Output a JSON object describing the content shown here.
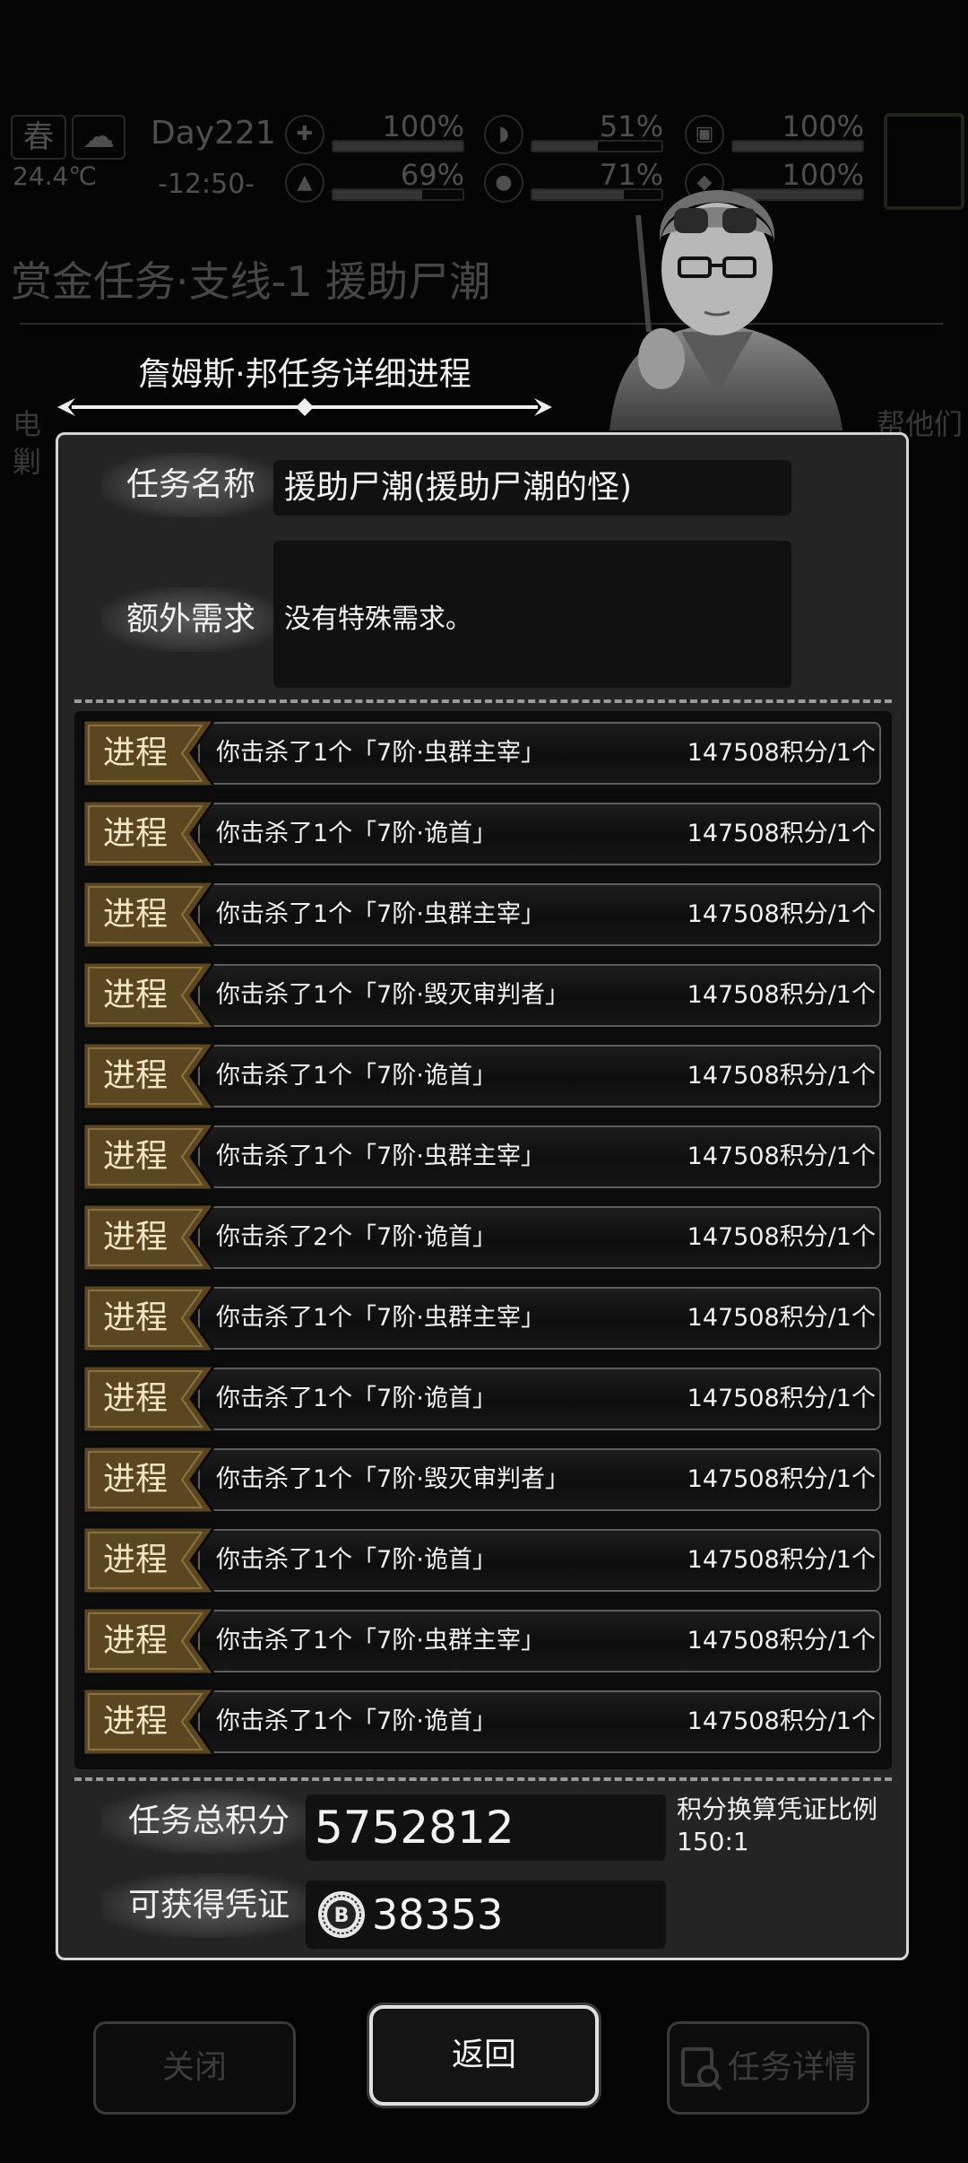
{
  "hud": {
    "season": "春",
    "weather_icon": "cloud-rain-icon",
    "temperature": "24.4℃",
    "day": "Day221",
    "time": "-12:50-",
    "stats": [
      {
        "icon": "medkit-icon",
        "percent": "100%",
        "level": 1.0
      },
      {
        "icon": "stomach-icon",
        "percent": "51%",
        "level": 0.51
      },
      {
        "icon": "shield-icon",
        "percent": "100%",
        "level": 1.0
      },
      {
        "icon": "thermometer-icon",
        "percent": "69%",
        "level": 0.69
      },
      {
        "icon": "water-drop-icon",
        "percent": "71%",
        "level": 0.71
      },
      {
        "icon": "stamina-icon",
        "percent": "100%",
        "level": 1.0
      }
    ]
  },
  "background": {
    "quest_title": "赏金任务·支线-1 援助尸潮",
    "desc_line1": "电",
    "desc_line2_right": "帮他们",
    "desc_line3": "剿"
  },
  "dialog": {
    "header": "詹姆斯·邦任务详细进程",
    "task_name_label": "任务名称",
    "task_name": "援助尸潮(援助尸潮的怪)",
    "extra_req_label": "额外需求",
    "extra_req": "没有特殊需求。",
    "progress_badge": "进程",
    "progress": [
      {
        "desc": "你击杀了1个「7阶·虫群主宰」",
        "points": "147508积分/1个"
      },
      {
        "desc": "你击杀了1个「7阶·诡首」",
        "points": "147508积分/1个"
      },
      {
        "desc": "你击杀了1个「7阶·虫群主宰」",
        "points": "147508积分/1个"
      },
      {
        "desc": "你击杀了1个「7阶·毁灭审判者」",
        "points": "147508积分/1个"
      },
      {
        "desc": "你击杀了1个「7阶·诡首」",
        "points": "147508积分/1个"
      },
      {
        "desc": "你击杀了1个「7阶·虫群主宰」",
        "points": "147508积分/1个"
      },
      {
        "desc": "你击杀了2个「7阶·诡首」",
        "points": "147508积分/1个"
      },
      {
        "desc": "你击杀了1个「7阶·虫群主宰」",
        "points": "147508积分/1个"
      },
      {
        "desc": "你击杀了1个「7阶·诡首」",
        "points": "147508积分/1个"
      },
      {
        "desc": "你击杀了1个「7阶·毁灭审判者」",
        "points": "147508积分/1个"
      },
      {
        "desc": "你击杀了1个「7阶·诡首」",
        "points": "147508积分/1个"
      },
      {
        "desc": "你击杀了1个「7阶·虫群主宰」",
        "points": "147508积分/1个"
      },
      {
        "desc": "你击杀了1个「7阶·诡首」",
        "points": "147508积分/1个"
      }
    ],
    "total_label": "任务总积分",
    "total_value": "5752812",
    "ratio_label": "积分换算凭证比例",
    "ratio_value": "150:1",
    "voucher_label": "可获得凭证",
    "voucher_value": "38353"
  },
  "buttons": {
    "close": "关闭",
    "back": "返回",
    "detail": "任务详情"
  },
  "colors": {
    "badge_gold": "#5a4722",
    "panel_border": "#d4d4d4",
    "slot_green": "#5a6a46"
  }
}
